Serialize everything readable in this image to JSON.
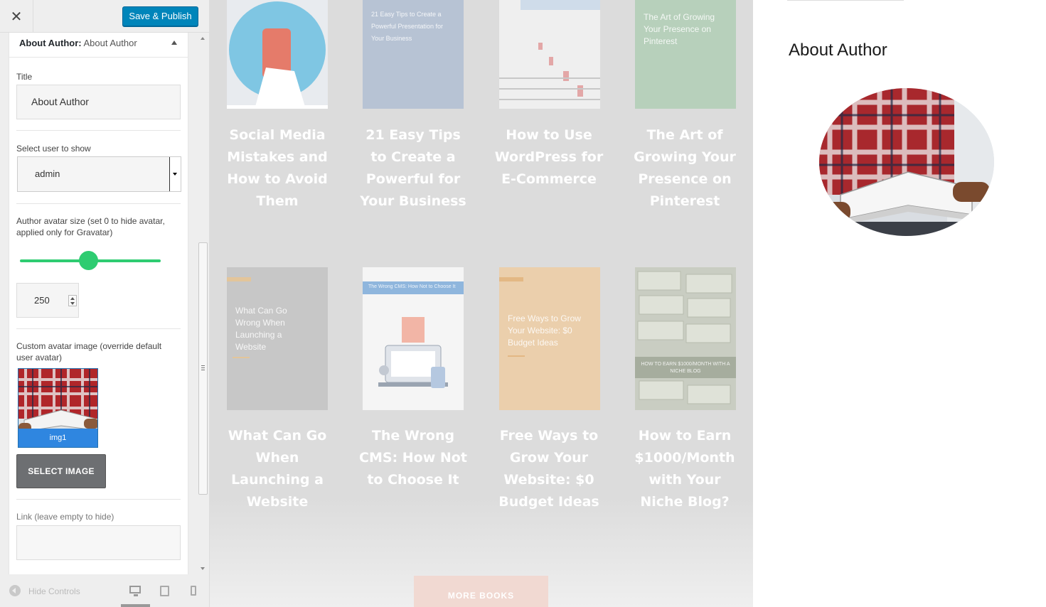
{
  "sidebar": {
    "close_glyph": "✕",
    "publish_label": "Save & Publish",
    "widget": {
      "title_lead": "About Author:",
      "title_rest": "About Author"
    },
    "fields": {
      "title_label": "Title",
      "title_value": "About Author",
      "user_label": "Select user to show",
      "user_value": "admin",
      "avatar_size_label": "Author avatar size (set 0 to hide avatar, applied only for Gravatar)",
      "avatar_size_value": "250",
      "custom_avatar_label": "Custom avatar image (override default user avatar)",
      "image_caption": "img1",
      "select_image_label": "SELECT IMAGE",
      "link_label": "Link (leave empty to hide)"
    },
    "footer": {
      "hide_label": "Hide Controls"
    }
  },
  "preview": {
    "books": [
      {
        "title": "Social Media Mistakes and How to Avoid Them",
        "cover_text": "",
        "cover_color": "#e9edf2"
      },
      {
        "title": "21 Easy Tips to Create a Powerful for Your Business",
        "cover_text": "21 Easy Tips to Create a Powerful Presentation for Your Business",
        "cover_color": "#b8c4d4"
      },
      {
        "title": "How to Use WordPress for E-Commerce",
        "cover_text": "",
        "cover_color": "#e6e6e6"
      },
      {
        "title": "The Art of Growing Your Presence on Pinterest",
        "cover_text": "The Art of Growing Your Presence on Pinterest",
        "cover_color": "#b9d1bd"
      },
      {
        "title": "What Can Go When Launching a Website",
        "cover_text": "What Can Go Wrong When Launching a Website",
        "cover_color": "#c9c9c9"
      },
      {
        "title": "The Wrong CMS: How Not to Choose It",
        "cover_text": "The Wrong CMS: How Not to Choose It",
        "cover_color": "#f4f4f4"
      },
      {
        "title": "Free Ways to Grow Your Website: $0 Budget Ideas",
        "cover_text": "Free Ways to Grow Your Website: $0 Budget Ideas",
        "cover_color": "#e9cfae"
      },
      {
        "title": "How to Earn $1000/Month with Your Niche Blog?",
        "cover_text": "HOW TO EARN $1000/MONTH WITH A NICHE BLOG",
        "cover_color": "#c8ccc0"
      }
    ],
    "more_books_label": "MORE BOOKS",
    "widget_title": "About Author"
  }
}
